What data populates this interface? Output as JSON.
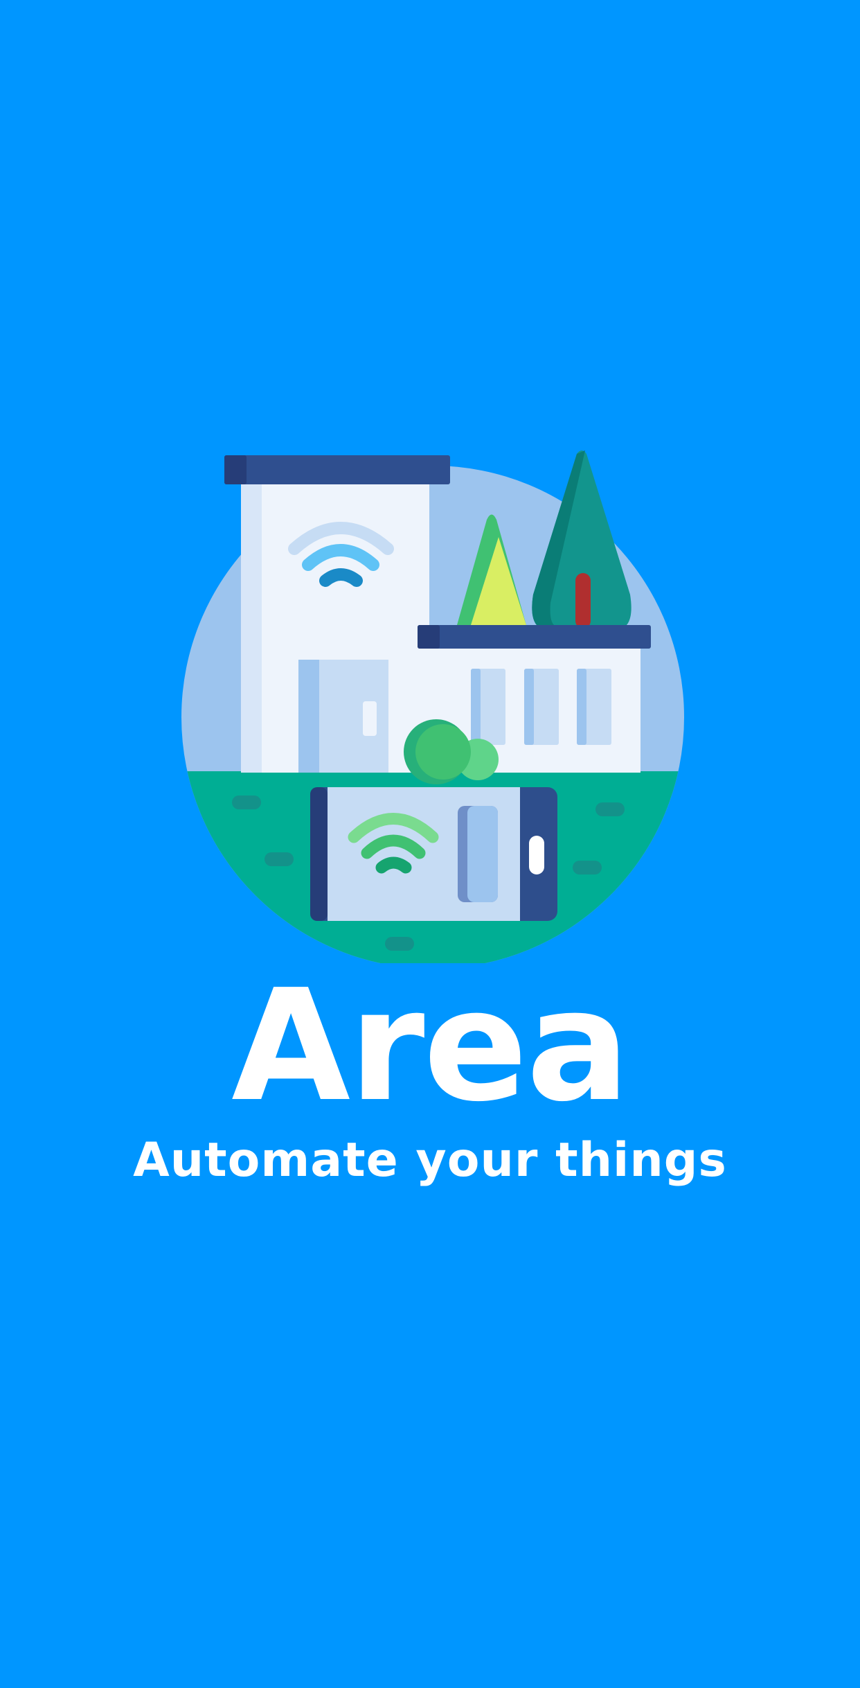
{
  "splash": {
    "app_name": "Area",
    "tagline": "Automate your things",
    "illustration": "smart-home-illustration"
  },
  "colors": {
    "background": "#0096FF",
    "text": "#FFFFFF",
    "sky_circle": "#9CC4EE",
    "ground": "#00AE94",
    "roof": "#2F4F8F",
    "building": "#EEF4FC",
    "phone_body": "#2E4E8C"
  }
}
